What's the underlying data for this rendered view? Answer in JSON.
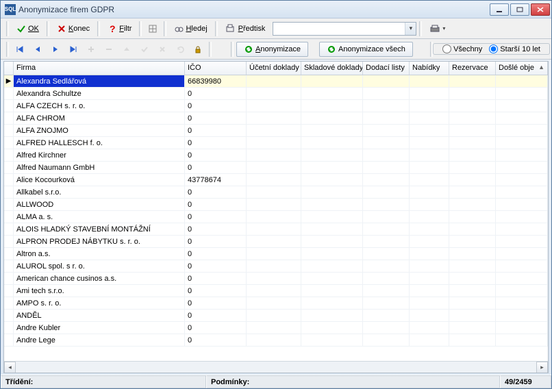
{
  "window": {
    "title": "Anonymizace firem GDPR",
    "icon_text": "SQL"
  },
  "toolbar1": {
    "ok": "OK",
    "konec": "Konec",
    "filtr": "Filtr",
    "hledej": "Hledej",
    "predtisk": "Předtisk"
  },
  "toolbar2": {
    "anonymizace": "Anonymizace",
    "anonymizace_vsech": "Anonymizace všech",
    "radio_vsechny": "Všechny",
    "radio_starsi": "Starší 10 let",
    "radio_selected": "starsi"
  },
  "columns": {
    "firma": "Firma",
    "ico": "IČO",
    "ucetni": "Účetní doklady",
    "sklad": "Skladové doklady",
    "dodaci": "Dodací listy",
    "nabidky": "Nabídky",
    "rezervace": "Rezervace",
    "dosle": "Došlé obje"
  },
  "rows": [
    {
      "firma": "Alexandra Sedlářová",
      "ico": "66839980",
      "selected": true
    },
    {
      "firma": "Alexandra Schultze",
      "ico": "0"
    },
    {
      "firma": "ALFA CZECH s. r. o.",
      "ico": "0"
    },
    {
      "firma": "ALFA CHROM",
      "ico": "0"
    },
    {
      "firma": "ALFA ZNOJMO",
      "ico": "0"
    },
    {
      "firma": "ALFRED HALLESCH f. o.",
      "ico": "0"
    },
    {
      "firma": "Alfred Kirchner",
      "ico": "0"
    },
    {
      "firma": "Alfred Naumann GmbH",
      "ico": "0"
    },
    {
      "firma": "Alice Kocourková",
      "ico": "43778674"
    },
    {
      "firma": "Allkabel s.r.o.",
      "ico": "0"
    },
    {
      "firma": "ALLWOOD",
      "ico": "0"
    },
    {
      "firma": "ALMA a. s.",
      "ico": "0"
    },
    {
      "firma": "ALOIS HLADKÝ STAVEBNÍ MONTÁŽNÍ",
      "ico": "0"
    },
    {
      "firma": "ALPRON PRODEJ NÁBYTKU s. r. o.",
      "ico": "0"
    },
    {
      "firma": "Altron a.s.",
      "ico": "0"
    },
    {
      "firma": "ALUROL spol. s r. o.",
      "ico": "0"
    },
    {
      "firma": "American chance cusinos a.s.",
      "ico": "0"
    },
    {
      "firma": "Ami tech s.r.o.",
      "ico": "0"
    },
    {
      "firma": "AMPO s. r. o.",
      "ico": "0"
    },
    {
      "firma": "ANDĚL",
      "ico": "0"
    },
    {
      "firma": "Andre Kubler",
      "ico": "0"
    },
    {
      "firma": "Andre Lege",
      "ico": "0"
    }
  ],
  "status": {
    "trideni_label": "Třídění:",
    "podminky_label": "Podmínky:",
    "counter": "49/2459"
  }
}
